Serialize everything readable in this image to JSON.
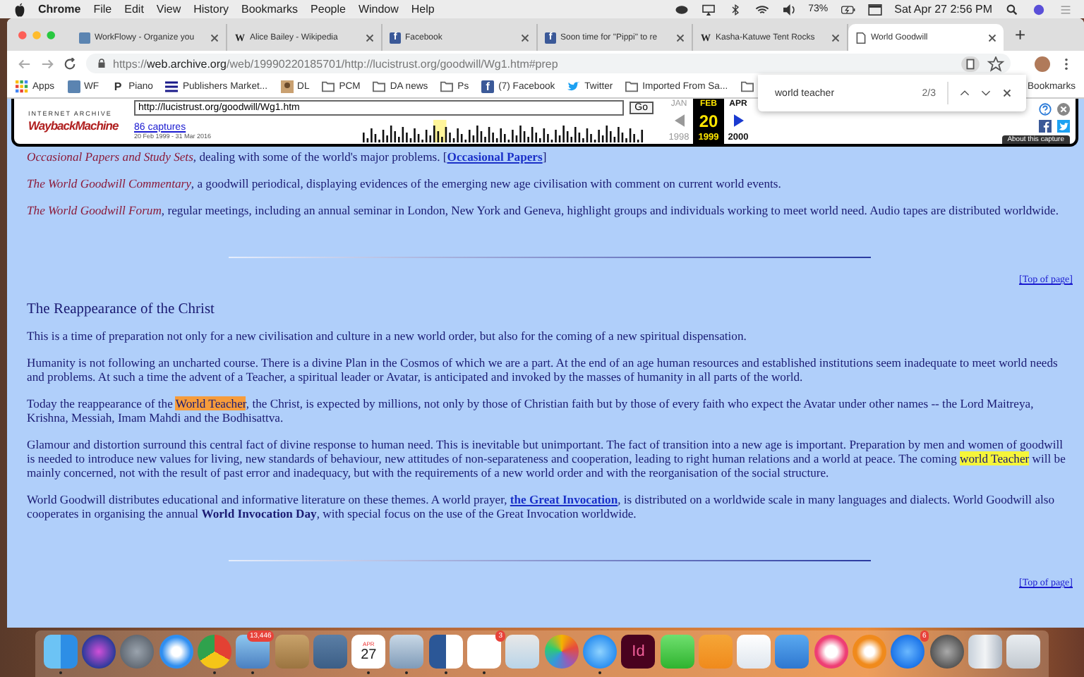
{
  "menubar": {
    "app": "Chrome",
    "menus": [
      "File",
      "Edit",
      "View",
      "History",
      "Bookmarks",
      "People",
      "Window",
      "Help"
    ],
    "battery": "73%",
    "clock": "Sat Apr 27  2:56 PM"
  },
  "tabs": [
    {
      "title": "WorkFlowy - Organize you",
      "kind": "workflowy",
      "selected": false
    },
    {
      "title": "Alice Bailey - Wikipedia",
      "kind": "letter",
      "icon_text": "W",
      "selected": false
    },
    {
      "title": "Facebook",
      "kind": "facebook",
      "icon_text": "f",
      "selected": false
    },
    {
      "title": "Soon time for \"Pippi\" to re",
      "kind": "facebook",
      "icon_text": "f",
      "selected": false
    },
    {
      "title": "Kasha-Katuwe Tent Rocks",
      "kind": "letter",
      "icon_text": "W",
      "selected": false
    },
    {
      "title": "World Goodwill",
      "kind": "page",
      "selected": true
    }
  ],
  "new_tab": "+",
  "address": {
    "scheme": "https://",
    "host": "web.archive.org",
    "path": "/web/19990220185701/http://lucistrust.org/goodwill/Wg1.htm#prep"
  },
  "bookmarks": [
    {
      "kind": "apps",
      "label": "Apps"
    },
    {
      "kind": "workflowy",
      "label": "WF"
    },
    {
      "kind": "letter",
      "icon_text": "P",
      "label": "Piano"
    },
    {
      "kind": "lines",
      "label": "Publishers Market..."
    },
    {
      "kind": "photo",
      "label": "DL"
    },
    {
      "kind": "folder",
      "label": "PCM"
    },
    {
      "kind": "folder",
      "label": "DA news"
    },
    {
      "kind": "folder",
      "label": "Ps"
    },
    {
      "kind": "facebook",
      "icon_text": "f",
      "label": "(7) Facebook"
    },
    {
      "kind": "bird",
      "label": "Twitter"
    },
    {
      "kind": "folder",
      "label": "Imported From Sa..."
    },
    {
      "kind": "folder"
    }
  ],
  "other_bookmarks": "Bookmarks",
  "find_bar": {
    "query": "world teacher",
    "count": "2/3"
  },
  "wayback": {
    "logo_top": "INTERNET ARCHIVE",
    "logo": "WaybackMachine",
    "url": "http://lucistrust.org/goodwill/Wg1.htm",
    "go": "Go",
    "captures": "86 captures",
    "range": "20 Feb 1999 - 31 Mar 2016",
    "prev_month": "JAN",
    "month": "FEB",
    "next_month": "APR",
    "day": "20",
    "prev_year": "1998",
    "year": "1999",
    "next_year": "2000",
    "about": "About this capture"
  },
  "sections": [
    {
      "paragraphs": [
        [
          {
            "kind": "title",
            "text": "Occasional Papers and Study Sets"
          },
          {
            "kind": "plain",
            "text": ", dealing with some of the world's major problems. ["
          },
          {
            "kind": "link",
            "text": "Occasional Papers"
          },
          {
            "kind": "plain",
            "text": "]"
          }
        ],
        [
          {
            "kind": "title",
            "text": "The World Goodwill Commentary"
          },
          {
            "kind": "plain",
            "text": ", a goodwill periodical, displaying evidences of the emerging new age civilisation with comment on current world events."
          }
        ],
        [
          {
            "kind": "title",
            "text": "The World Goodwill Forum"
          },
          {
            "kind": "plain",
            "text": ", regular meetings, including an annual seminar in London, New York and Geneva, highlight groups and individuals working to meet world need. Audio tapes are distributed worldwide."
          }
        ]
      ],
      "top_link": "[Top of page]"
    },
    {
      "heading": "The Reappearance of the Christ",
      "paragraphs": [
        [
          {
            "kind": "plain",
            "text": "This is a time of preparation not only for a new civilisation and culture in a new world order, but also for the coming of a new spiritual dispensation."
          }
        ],
        [
          {
            "kind": "plain",
            "text": "Humanity is not following an uncharted course. There is a divine Plan in the Cosmos of which we are a part. At the end of an age human resources and established institutions seem inadequate to meet world needs and problems. At such a time the advent of a Teacher, a spiritual leader or Avatar, is anticipated and invoked by the masses of humanity in all parts of the world."
          }
        ],
        [
          {
            "kind": "plain",
            "text": "Today the reappearance of the "
          },
          {
            "kind": "current_match",
            "text": "World Teacher"
          },
          {
            "kind": "plain",
            "text": ", the Christ, is expected by millions, not only by those of Christian faith but by those of every faith who expect the Avatar under other names -- the Lord Maitreya, Krishna, Messiah, Imam Mahdi and the Bodhisattva."
          }
        ],
        [
          {
            "kind": "plain",
            "text": "Glamour and distortion surround this central fact of divine response to human need. This is inevitable but unimportant. The fact of transition into a new age is important. Preparation by men and women of goodwill is needed to introduce new values for living, new standards of behaviour, new attitudes of non-separateness and cooperation, leading to right human relations and a world at peace. The coming "
          },
          {
            "kind": "match",
            "text": "world Teacher"
          },
          {
            "kind": "plain",
            "text": " will be mainly concerned, not with the result of past error and inadequacy, but with the requirements of a new world order and with the reorganisation of the social structure."
          }
        ],
        [
          {
            "kind": "plain",
            "text": "World Goodwill distributes educational and informative literature on these themes. A world prayer, "
          },
          {
            "kind": "link",
            "text": "the Great Invocation"
          },
          {
            "kind": "plain",
            "text": ", is distributed on a worldwide scale in many languages and dialects. World Goodwill also cooperates in organising the annual "
          },
          {
            "kind": "bold",
            "text": "World Invocation Day"
          },
          {
            "kind": "plain",
            "text": ", with special focus on the use of the Great Invocation worldwide."
          }
        ]
      ],
      "top_link": "[Top of page]"
    }
  ],
  "dock": [
    {
      "kind": "finder",
      "running": true
    },
    {
      "kind": "siri",
      "running": false
    },
    {
      "kind": "launchpad",
      "running": false
    },
    {
      "kind": "safari",
      "running": false
    },
    {
      "kind": "chrome",
      "running": true
    },
    {
      "kind": "mail",
      "badge": "13,446",
      "running": true
    },
    {
      "kind": "notebook",
      "running": false
    },
    {
      "kind": "list",
      "running": false
    },
    {
      "kind": "calendar",
      "month": "APR",
      "day": "27",
      "running": true
    },
    {
      "kind": "preview",
      "running": true
    },
    {
      "kind": "word",
      "running": true
    },
    {
      "kind": "reminders",
      "badge": "3",
      "running": true
    },
    {
      "kind": "utility",
      "running": false
    },
    {
      "kind": "photos",
      "running": false
    },
    {
      "kind": "messages",
      "running": true
    },
    {
      "kind": "indesign",
      "text": "Id",
      "running": false
    },
    {
      "kind": "facetime",
      "running": false
    },
    {
      "kind": "pages",
      "running": false
    },
    {
      "kind": "numbers",
      "running": false
    },
    {
      "kind": "keynote",
      "running": false
    },
    {
      "kind": "music",
      "running": false
    },
    {
      "kind": "books",
      "running": false
    },
    {
      "kind": "appstore",
      "badge": "6",
      "running": false
    },
    {
      "kind": "settings",
      "running": false
    },
    {
      "kind": "device",
      "running": false
    },
    {
      "kind": "trash",
      "running": false
    }
  ]
}
